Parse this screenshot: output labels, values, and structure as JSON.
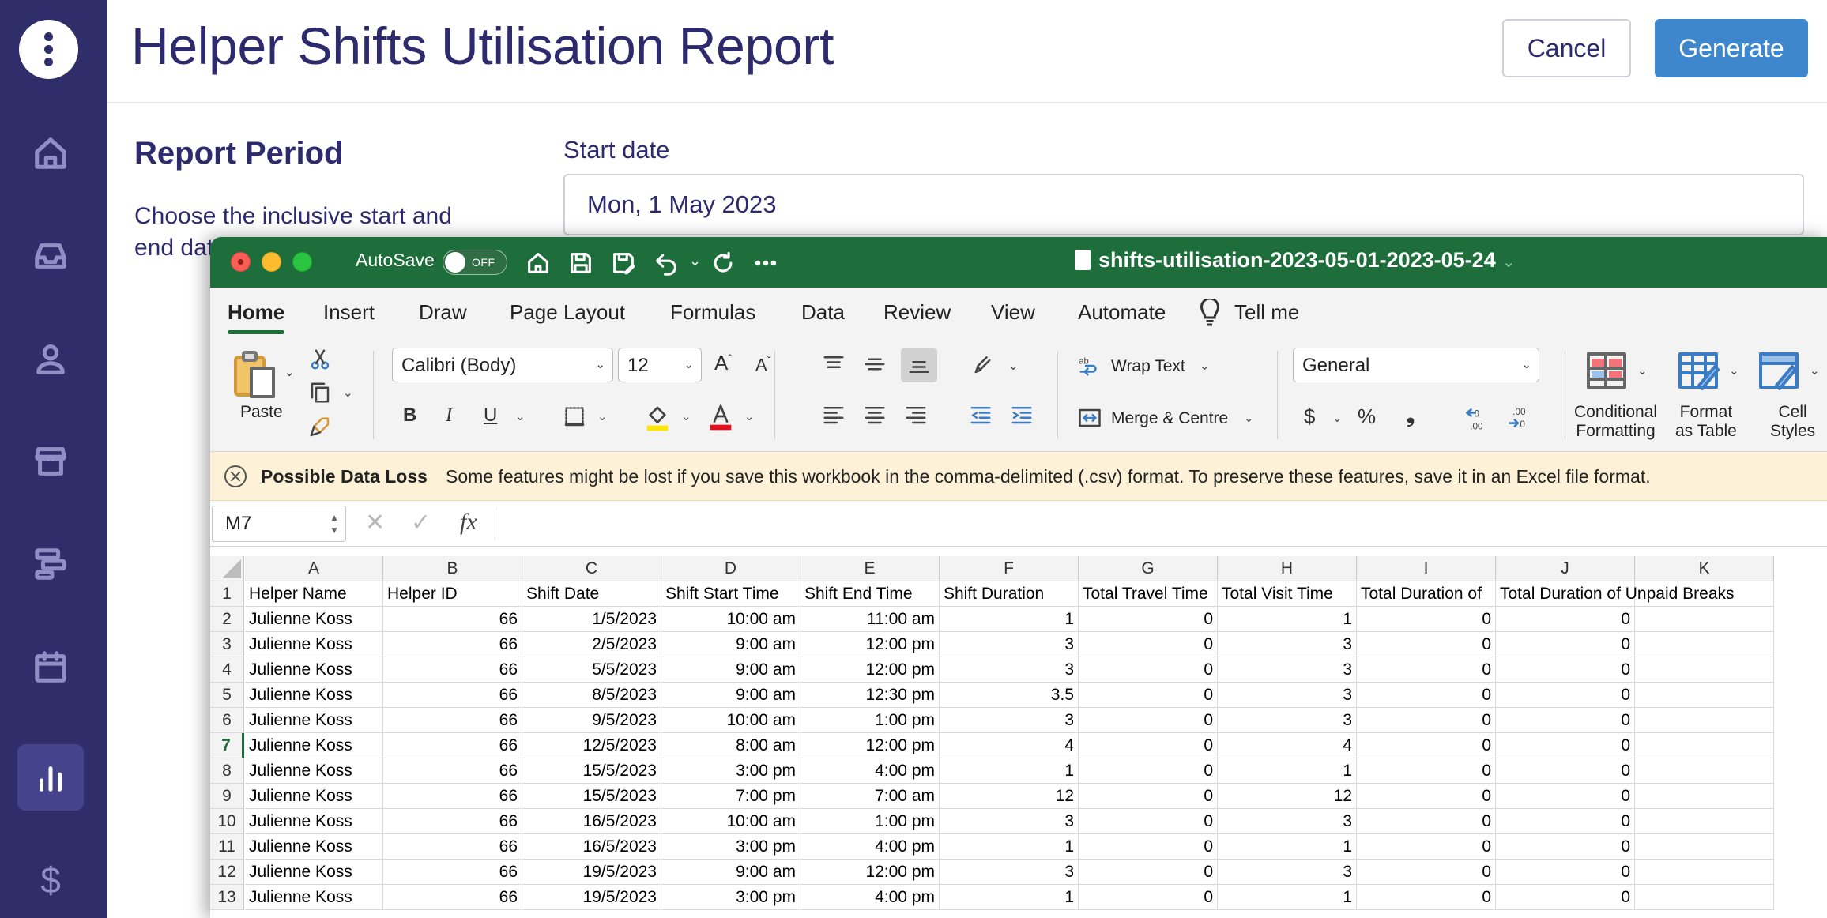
{
  "app": {
    "title": "Helper Shifts Utilisation Report",
    "cancel_label": "Cancel",
    "generate_label": "Generate",
    "report_period_heading": "Report Period",
    "report_period_desc": "Choose the inclusive start and end date",
    "start_date_label": "Start date",
    "start_date_value": "Mon, 1 May 2023",
    "nav_icons": [
      "home-icon",
      "inbox-icon",
      "person-icon",
      "store-icon",
      "roster-icon",
      "calendar-icon",
      "bar-chart-icon",
      "dollar-icon"
    ],
    "dollar_glyph": "$",
    "active_nav": "reports"
  },
  "excel": {
    "autosave_label": "AutoSave",
    "autosave_state": "OFF",
    "filename": "shifts-utilisation-2023-05-01-2023-05-24",
    "tabs": [
      "Home",
      "Insert",
      "Draw",
      "Page Layout",
      "Formulas",
      "Data",
      "Review",
      "View",
      "Automate",
      "Tell me"
    ],
    "active_tab": "Home",
    "ribbon": {
      "paste_label": "Paste",
      "font_name": "Calibri (Body)",
      "font_size": "12",
      "bold": "B",
      "italic": "I",
      "underline": "U",
      "wrap_text": "Wrap Text",
      "merge_centre": "Merge & Centre",
      "number_format": "General",
      "currency": "$",
      "percent": "%",
      "comma": "❟",
      "conditional_formatting_1": "Conditional",
      "conditional_formatting_2": "Formatting",
      "format_table_1": "Format",
      "format_table_2": "as Table",
      "cell_styles_1": "Cell",
      "cell_styles_2": "Styles",
      "dec_inc": ".00",
      "dec_dec": ".00"
    },
    "message": {
      "title": "Possible Data Loss",
      "text": "Some features might be lost if you save this workbook in the comma-delimited (.csv) format. To preserve these features, save it in an Excel file format."
    },
    "name_box": "M7",
    "fx": "fx",
    "columns": [
      "A",
      "B",
      "C",
      "D",
      "E",
      "F",
      "G",
      "H",
      "I",
      "J",
      "K"
    ],
    "header_row": [
      "Helper Name",
      "Helper ID",
      "Shift Date",
      "Shift Start Time",
      "Shift End Time",
      "Shift Duration",
      "Total Travel Time",
      "Total Visit Time",
      "Total Duration of",
      "Total Duration of Unpaid Breaks",
      ""
    ],
    "rows": [
      [
        "Julienne Koss",
        "66",
        "1/5/2023",
        "10:00 am",
        "11:00 am",
        "1",
        "0",
        "1",
        "0",
        "0",
        ""
      ],
      [
        "Julienne Koss",
        "66",
        "2/5/2023",
        "9:00 am",
        "12:00 pm",
        "3",
        "0",
        "3",
        "0",
        "0",
        ""
      ],
      [
        "Julienne Koss",
        "66",
        "5/5/2023",
        "9:00 am",
        "12:00 pm",
        "3",
        "0",
        "3",
        "0",
        "0",
        ""
      ],
      [
        "Julienne Koss",
        "66",
        "8/5/2023",
        "9:00 am",
        "12:30 pm",
        "3.5",
        "0",
        "3",
        "0",
        "0",
        ""
      ],
      [
        "Julienne Koss",
        "66",
        "9/5/2023",
        "10:00 am",
        "1:00 pm",
        "3",
        "0",
        "3",
        "0",
        "0",
        ""
      ],
      [
        "Julienne Koss",
        "66",
        "12/5/2023",
        "8:00 am",
        "12:00 pm",
        "4",
        "0",
        "4",
        "0",
        "0",
        ""
      ],
      [
        "Julienne Koss",
        "66",
        "15/5/2023",
        "3:00 pm",
        "4:00 pm",
        "1",
        "0",
        "1",
        "0",
        "0",
        ""
      ],
      [
        "Julienne Koss",
        "66",
        "15/5/2023",
        "7:00 pm",
        "7:00 am",
        "12",
        "0",
        "12",
        "0",
        "0",
        ""
      ],
      [
        "Julienne Koss",
        "66",
        "16/5/2023",
        "10:00 am",
        "1:00 pm",
        "3",
        "0",
        "3",
        "0",
        "0",
        ""
      ],
      [
        "Julienne Koss",
        "66",
        "16/5/2023",
        "3:00 pm",
        "4:00 pm",
        "1",
        "0",
        "1",
        "0",
        "0",
        ""
      ],
      [
        "Julienne Koss",
        "66",
        "19/5/2023",
        "9:00 am",
        "12:00 pm",
        "3",
        "0",
        "3",
        "0",
        "0",
        ""
      ],
      [
        "Julienne Koss",
        "66",
        "19/5/2023",
        "3:00 pm",
        "4:00 pm",
        "1",
        "0",
        "1",
        "0",
        "0",
        ""
      ]
    ],
    "selected_row": 7,
    "colors": {
      "excel_green": "#1d6e3b",
      "sidebar": "#2f2e6b",
      "accent_blue": "#3f87cc"
    }
  }
}
